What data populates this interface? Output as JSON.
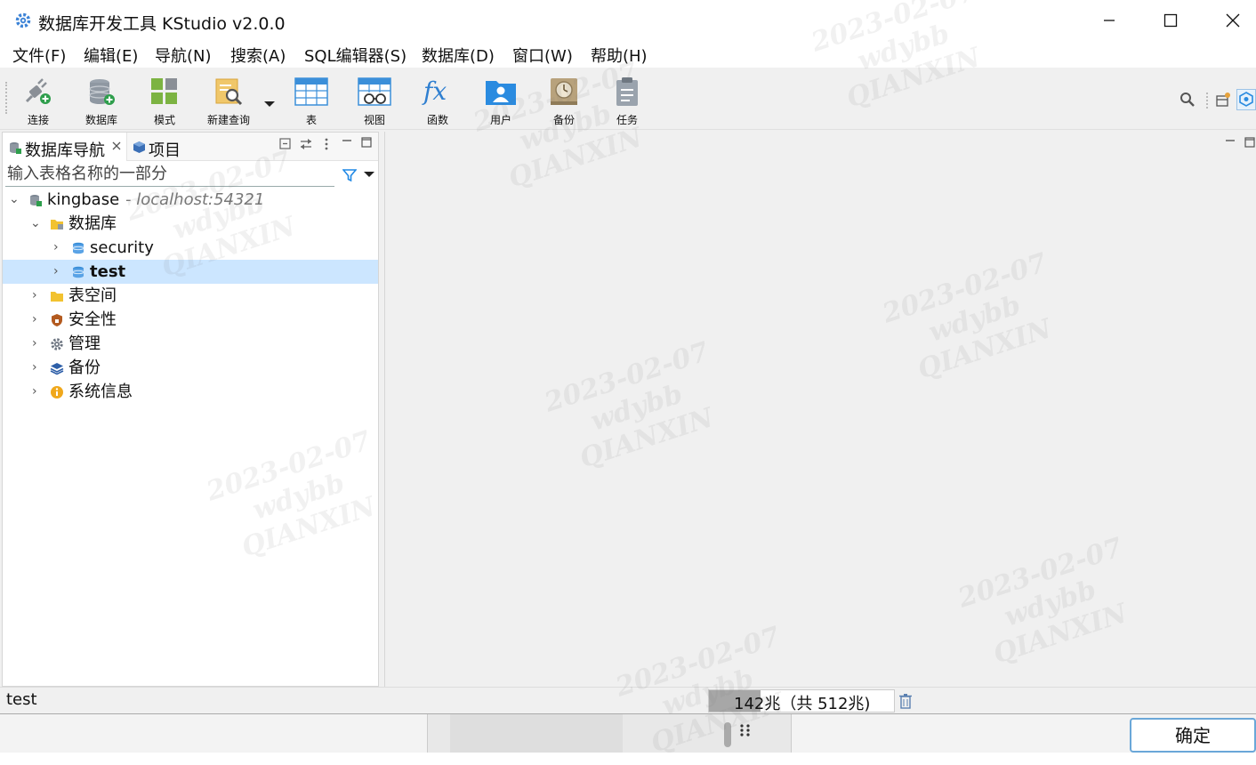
{
  "window": {
    "title": "数据库开发工具 KStudio v2.0.0",
    "controls": [
      "minimize",
      "maximize",
      "close"
    ]
  },
  "menu": [
    {
      "label": "文件(F)"
    },
    {
      "label": "编辑(E)"
    },
    {
      "label": "导航(N)"
    },
    {
      "label": "搜索(A)"
    },
    {
      "label": "SQL编辑器(S)"
    },
    {
      "label": "数据库(D)"
    },
    {
      "label": "窗口(W)"
    },
    {
      "label": "帮助(H)"
    }
  ],
  "toolbar": {
    "items": [
      {
        "label": "连接",
        "icon": "plug-connect-icon"
      },
      {
        "label": "数据库",
        "icon": "database-add-icon"
      },
      {
        "label": "模式",
        "icon": "schema-icon"
      },
      {
        "label": "新建查询",
        "icon": "new-query-icon"
      },
      {
        "label": "表",
        "icon": "table-icon"
      },
      {
        "label": "视图",
        "icon": "view-icon"
      },
      {
        "label": "函数",
        "icon": "function-icon"
      },
      {
        "label": "用户",
        "icon": "user-icon"
      },
      {
        "label": "备份",
        "icon": "backup-icon"
      },
      {
        "label": "任务",
        "icon": "task-icon"
      }
    ]
  },
  "navigator": {
    "tabs": [
      {
        "label": "数据库导航",
        "icon": "db-navigator-icon"
      },
      {
        "label": "项目",
        "icon": "project-icon"
      }
    ],
    "filter_placeholder": "输入表格名称的一部分",
    "tree": [
      {
        "label": "kingbase",
        "sublabel": "- localhost:54321",
        "level": 0,
        "expanded": true,
        "icon": "connection-icon"
      },
      {
        "label": "数据库",
        "level": 1,
        "expanded": true,
        "icon": "folder-icon"
      },
      {
        "label": "security",
        "level": 2,
        "expanded": false,
        "icon": "database-icon"
      },
      {
        "label": "test",
        "level": 2,
        "expanded": false,
        "icon": "database-icon",
        "selected": true
      },
      {
        "label": "表空间",
        "level": 1,
        "expanded": false,
        "icon": "folder-icon"
      },
      {
        "label": "安全性",
        "level": 1,
        "expanded": false,
        "icon": "security-icon"
      },
      {
        "label": "管理",
        "level": 1,
        "expanded": false,
        "icon": "gear-icon"
      },
      {
        "label": "备份",
        "level": 1,
        "expanded": false,
        "icon": "layers-icon"
      },
      {
        "label": "系统信息",
        "level": 1,
        "expanded": false,
        "icon": "info-icon"
      }
    ]
  },
  "status": {
    "selection": "test",
    "heap_text": "142兆（共 512兆)",
    "heap_used_mb": 142,
    "heap_total_mb": 512
  },
  "dialog": {
    "ok_label": "确定"
  },
  "watermark": {
    "lines": [
      "2023-02-07",
      "wdybb",
      "QIANXIN"
    ]
  },
  "colors": {
    "selection": "#cce6ff",
    "accent": "#1e88e5"
  }
}
